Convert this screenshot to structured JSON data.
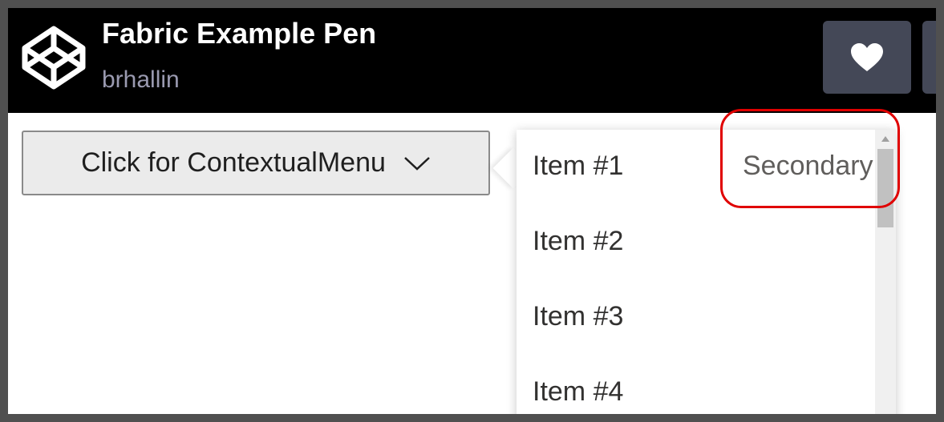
{
  "header": {
    "title": "Fabric Example Pen",
    "author": "brhallin",
    "logo_icon": "codepen-logo-icon",
    "heart_icon": "heart-icon"
  },
  "menu_button": {
    "label": "Click for ContextualMenu",
    "icon": "chevron-down-icon"
  },
  "contextual_menu": {
    "items": [
      {
        "label": "Item #1",
        "secondary": "Secondary"
      },
      {
        "label": "Item #2",
        "secondary": ""
      },
      {
        "label": "Item #3",
        "secondary": ""
      },
      {
        "label": "Item #4",
        "secondary": ""
      }
    ]
  },
  "colors": {
    "header_bg": "#000000",
    "author_text": "#9a9ab0",
    "action_button_bg": "#444857",
    "menu_button_bg": "#ebebeb",
    "annotation": "#e00000"
  }
}
